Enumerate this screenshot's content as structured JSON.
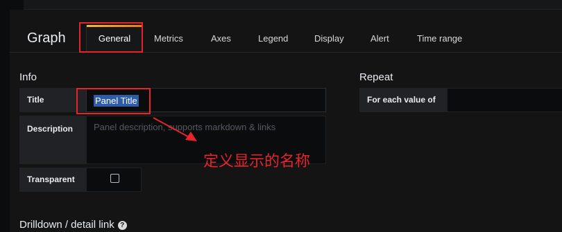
{
  "editor": {
    "title": "Graph",
    "tabs": [
      {
        "label": "General",
        "active": true
      },
      {
        "label": "Metrics"
      },
      {
        "label": "Axes"
      },
      {
        "label": "Legend"
      },
      {
        "label": "Display"
      },
      {
        "label": "Alert"
      },
      {
        "label": "Time range"
      }
    ]
  },
  "info": {
    "heading": "Info",
    "title_label": "Title",
    "title_value": "Panel Title",
    "description_label": "Description",
    "description_placeholder": "Panel description, supports markdown & links",
    "transparent_label": "Transparent",
    "transparent_checked": false
  },
  "repeat": {
    "heading": "Repeat",
    "for_each_label": "For each value of"
  },
  "drilldown": {
    "heading": "Drilldown / detail link",
    "help_icon": "question-circle-icon"
  },
  "annotation": {
    "text": "定义显示的名称",
    "color": "#e8242a"
  },
  "colors": {
    "background": "#141414",
    "accent": "#eb7b18",
    "selection": "#2f5ca8"
  }
}
